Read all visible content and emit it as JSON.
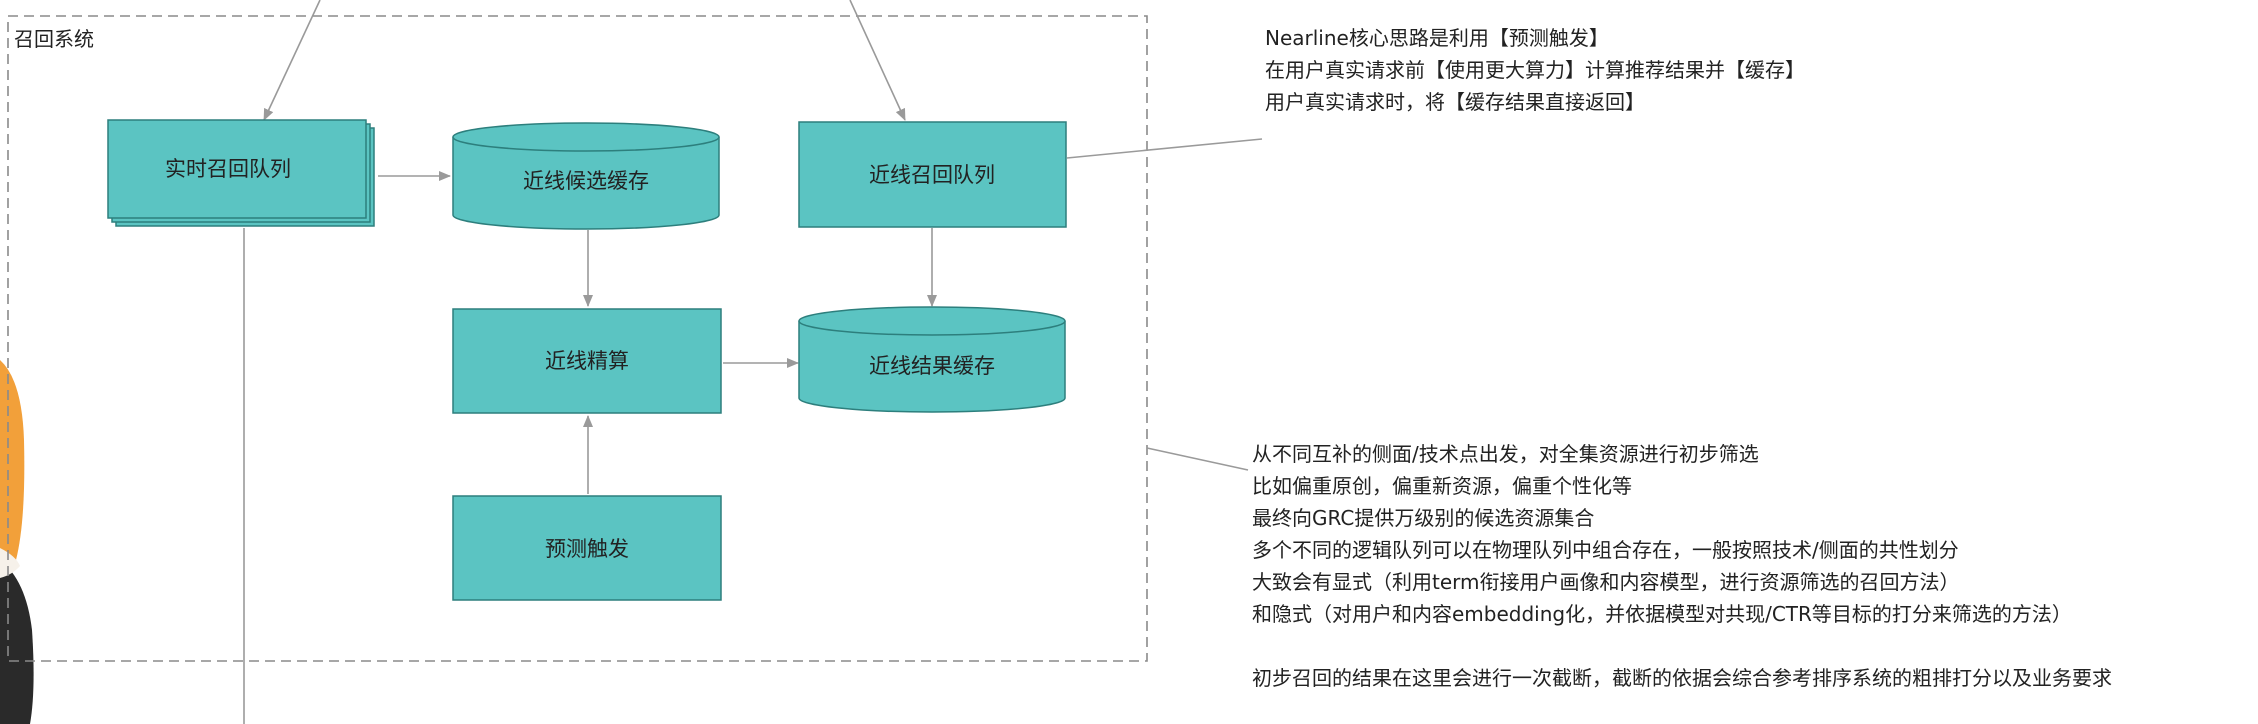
{
  "system_label": "召回系统",
  "colors": {
    "node_fill": "#5bc4c2",
    "node_stroke": "#2d7f7d",
    "frame_stroke": "#8a8a8a",
    "line": "#9a9a9a",
    "person_orange": "#f2a03a",
    "person_dark": "#2a2a2a"
  },
  "nodes": {
    "realtime_queue": "实时召回队列",
    "candidate_cache": "近线候选缓存",
    "nearline_queue": "近线召回队列",
    "nearline_compute": "近线精算",
    "result_cache": "近线结果缓存",
    "predict_trigger": "预测触发"
  },
  "notes": {
    "nearline": [
      "Nearline核心思路是利用【预测触发】",
      "在用户真实请求前【使用更大算力】计算推荐结果并【缓存】",
      "用户真实请求时，将【缓存结果直接返回】"
    ],
    "recall": [
      "从不同互补的侧面/技术点出发，对全集资源进行初步筛选",
      "比如偏重原创，偏重新资源，偏重个性化等",
      "最终向GRC提供万级别的候选资源集合",
      "多个不同的逻辑队列可以在物理队列中组合存在，一般按照技术/侧面的共性划分",
      "大致会有显式（利用term衔接用户画像和内容模型，进行资源筛选的召回方法）",
      "和隐式（对用户和内容embedding化，并依据模型对共现/CTR等目标的打分来筛选的方法）"
    ],
    "truncation": "初步召回的结果在这里会进行一次截断，截断的依据会综合参考排序系统的粗排打分以及业务要求"
  }
}
